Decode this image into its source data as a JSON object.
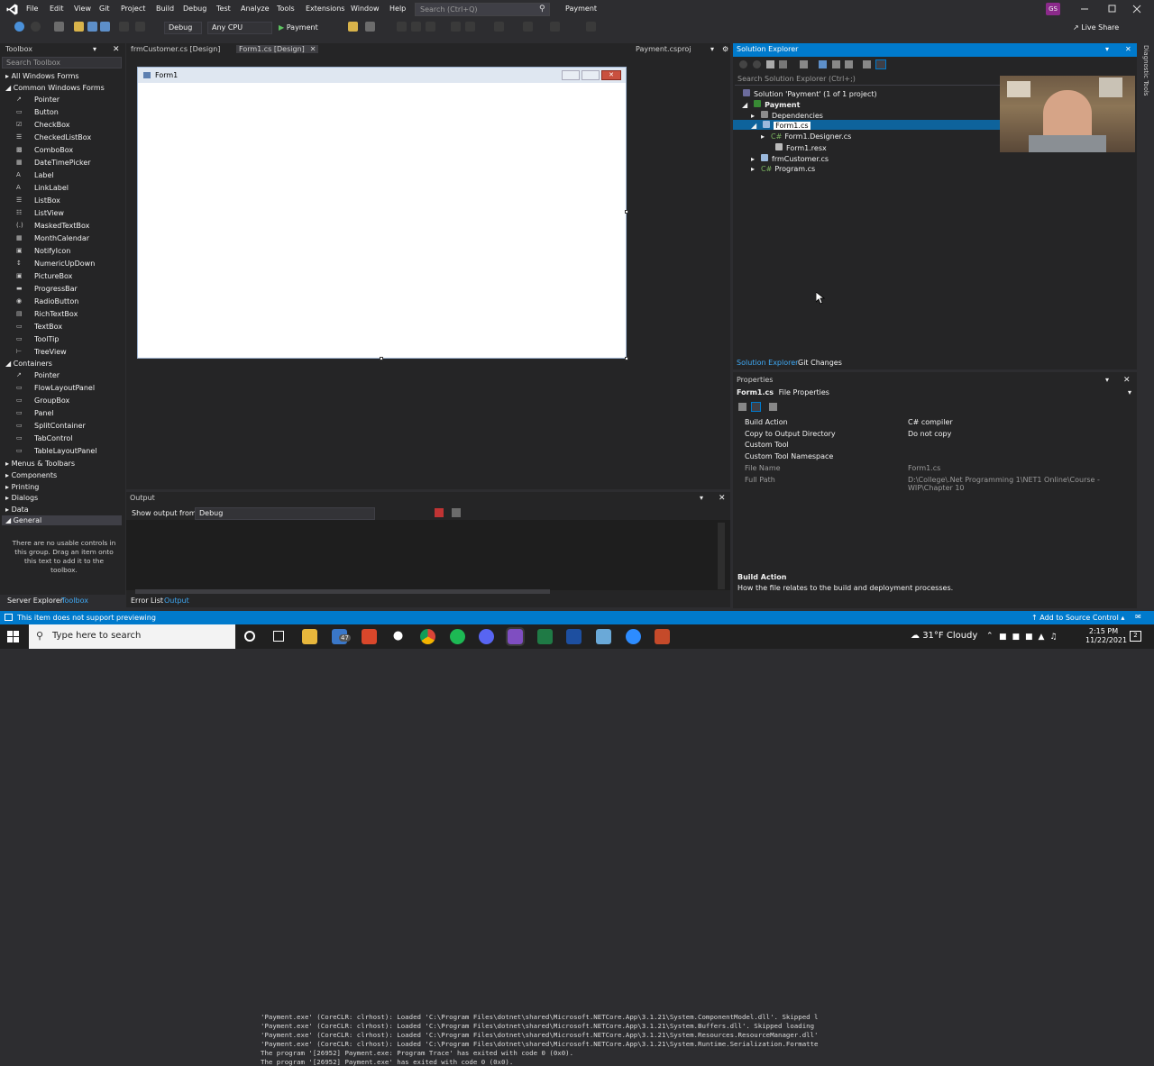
{
  "titlebar": {
    "menus": [
      "File",
      "Edit",
      "View",
      "Git",
      "Project",
      "Build",
      "Debug",
      "Test",
      "Analyze",
      "Tools",
      "Extensions",
      "Window",
      "Help"
    ],
    "search_placeholder": "Search (Ctrl+Q)",
    "solution_name": "Payment",
    "user_initials": "GS",
    "live_share": "Live Share"
  },
  "toolbar": {
    "config": "Debug",
    "platform": "Any CPU",
    "run_label": "Payment"
  },
  "toolbox": {
    "title": "Toolbox",
    "search_placeholder": "Search Toolbox",
    "categories_top": [
      "All Windows Forms",
      "Common Windows Forms"
    ],
    "common_items": [
      "Pointer",
      "Button",
      "CheckBox",
      "CheckedListBox",
      "ComboBox",
      "DateTimePicker",
      "Label",
      "LinkLabel",
      "ListBox",
      "ListView",
      "MaskedTextBox",
      "MonthCalendar",
      "NotifyIcon",
      "NumericUpDown",
      "PictureBox",
      "ProgressBar",
      "RadioButton",
      "RichTextBox",
      "TextBox",
      "ToolTip",
      "TreeView"
    ],
    "containers_label": "Containers",
    "container_items": [
      "Pointer",
      "FlowLayoutPanel",
      "GroupBox",
      "Panel",
      "SplitContainer",
      "TabControl",
      "TableLayoutPanel"
    ],
    "categories_bottom": [
      "Menus & Toolbars",
      "Components",
      "Printing",
      "Dialogs",
      "Data",
      "General"
    ],
    "empty_message": "There are no usable controls in this group. Drag an item onto this text to add it to the toolbox.",
    "bottom_tabs": [
      "Server Explorer",
      "Toolbox"
    ]
  },
  "editor": {
    "tabs": [
      "frmCustomer.cs [Design]",
      "Form1.cs [Design]"
    ],
    "right_tab": "Payment.csproj",
    "form_title": "Form1"
  },
  "output": {
    "title": "Output",
    "show_from_label": "Show output from:",
    "show_from_value": "Debug",
    "lines": [
      "'Payment.exe' (CoreCLR: clrhost): Loaded 'C:\\Program Files\\dotnet\\shared\\Microsoft.NETCore.App\\3.1.21\\System.ComponentModel.dll'. Skipped l",
      "'Payment.exe' (CoreCLR: clrhost): Loaded 'C:\\Program Files\\dotnet\\shared\\Microsoft.NETCore.App\\3.1.21\\System.Buffers.dll'. Skipped loading",
      "'Payment.exe' (CoreCLR: clrhost): Loaded 'C:\\Program Files\\dotnet\\shared\\Microsoft.NETCore.App\\3.1.21\\System.Resources.ResourceManager.dll'",
      "'Payment.exe' (CoreCLR: clrhost): Loaded 'C:\\Program Files\\dotnet\\shared\\Microsoft.NETCore.App\\3.1.21\\System.Runtime.Serialization.Formatte",
      "The program '[26952] Payment.exe: Program Trace' has exited with code 0 (0x0).",
      "The program '[26952] Payment.exe' has exited with code 0 (0x0)."
    ],
    "bottom_tabs": [
      "Error List",
      "Output"
    ]
  },
  "solution_explorer": {
    "title": "Solution Explorer",
    "search_placeholder": "Search Solution Explorer (Ctrl+;)",
    "solution": "Solution 'Payment' (1 of 1 project)",
    "project": "Payment",
    "dependencies": "Dependencies",
    "form1": "Form1.cs",
    "form1_designer": "Form1.Designer.cs",
    "form1_resx": "Form1.resx",
    "frm_customer": "frmCustomer.cs",
    "program": "Program.cs",
    "bottom_tabs": [
      "Solution Explorer",
      "Git Changes"
    ],
    "side_label": "Diagnostic Tools"
  },
  "properties": {
    "title": "Properties",
    "object_name": "Form1.cs",
    "object_type": "File Properties",
    "rows": [
      {
        "key": "Build Action",
        "value": "C# compiler"
      },
      {
        "key": "Copy to Output Directory",
        "value": "Do not copy"
      },
      {
        "key": "Custom Tool",
        "value": ""
      },
      {
        "key": "Custom Tool Namespace",
        "value": ""
      },
      {
        "key": "File Name",
        "value": "Form1.cs"
      },
      {
        "key": "Full Path",
        "value": "D:\\College\\.Net Programming 1\\NET1 Online\\Course - WIP\\Chapter 10"
      }
    ],
    "desc_title": "Build Action",
    "desc_text": "How the file relates to the build and deployment processes."
  },
  "status": {
    "message": "This item does not support previewing",
    "source_control": "Add to Source Control"
  },
  "taskbar": {
    "search_placeholder": "Type here to search",
    "mail_badge": "47",
    "weather": "31°F Cloudy",
    "time": "2:15 PM",
    "date": "11/22/2021",
    "notif_count": "2"
  },
  "colors": {
    "accent": "#007acc",
    "panel": "#252526",
    "chrome": "#2d2d30"
  }
}
